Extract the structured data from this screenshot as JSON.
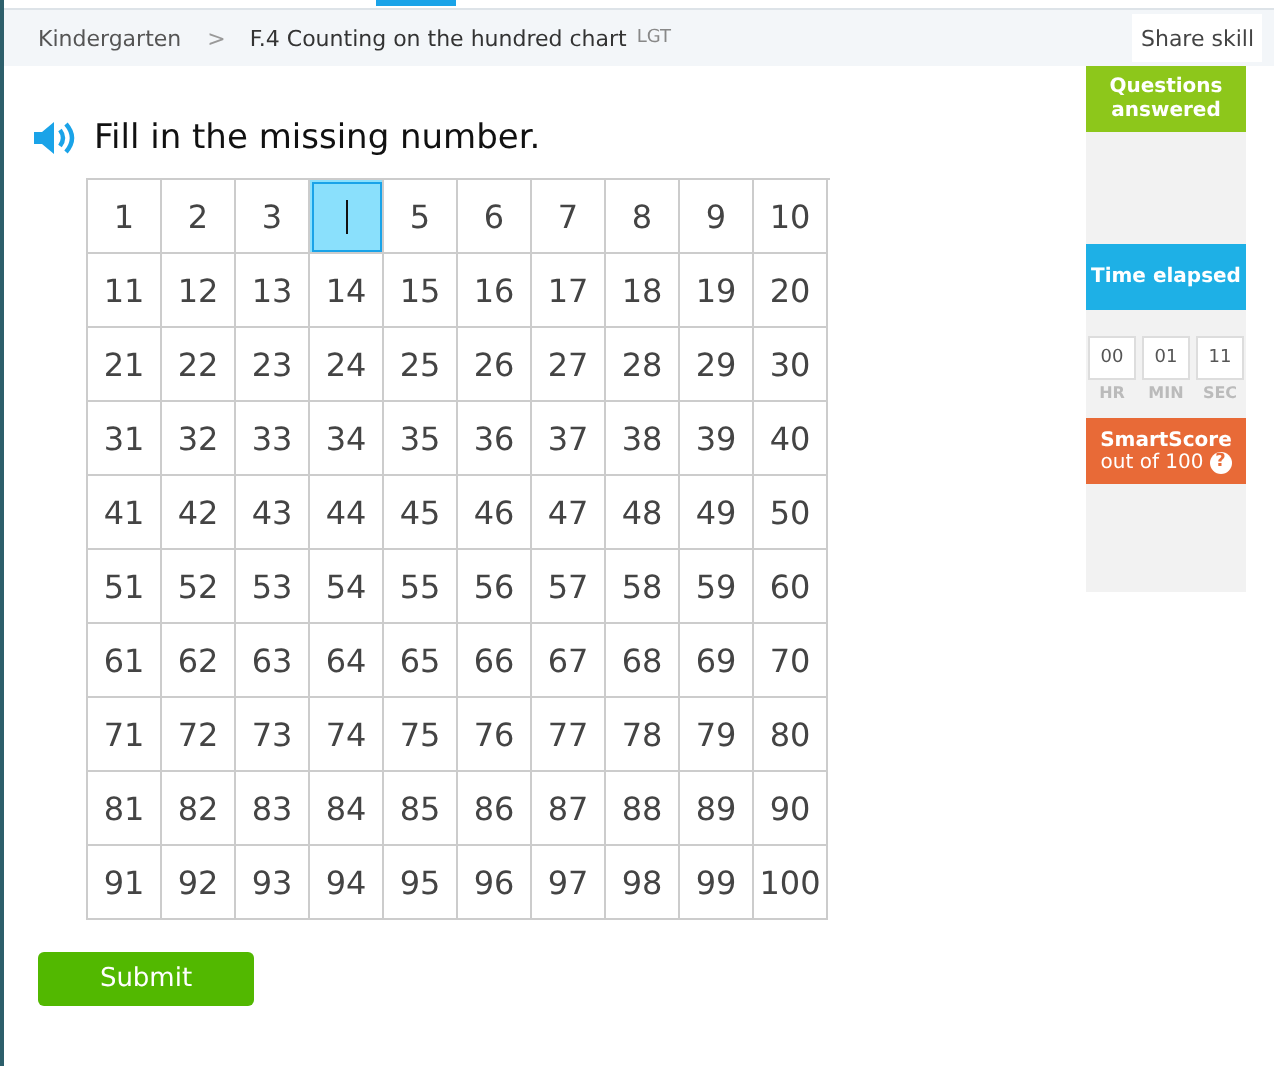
{
  "breadcrumb": {
    "grade": "Kindergarten",
    "separator": ">",
    "skill": "F.4 Counting on the hundred chart",
    "code": "LGT"
  },
  "share_button": "Share skill",
  "question": {
    "prompt": "Fill in the missing number."
  },
  "grid_rows": [
    [
      "1",
      "2",
      "3",
      {
        "kind": "input",
        "focused": true
      },
      "5",
      "6",
      "7",
      "8",
      "9",
      "10"
    ],
    [
      "11",
      "12",
      "13",
      "14",
      "15",
      "16",
      "17",
      "18",
      "19",
      "20"
    ],
    [
      "21",
      "22",
      "23",
      "24",
      "25",
      "26",
      "27",
      "28",
      "29",
      "30"
    ],
    [
      "31",
      "32",
      "33",
      "34",
      "35",
      "36",
      "37",
      "38",
      "39",
      "40"
    ],
    [
      "41",
      "42",
      "43",
      "44",
      "45",
      "46",
      "47",
      "48",
      "49",
      "50"
    ],
    [
      "51",
      "52",
      "53",
      "54",
      "55",
      "56",
      "57",
      "58",
      "59",
      "60"
    ],
    [
      "61",
      "62",
      "63",
      "64",
      "65",
      "66",
      "67",
      "68",
      "69",
      "70"
    ],
    [
      "71",
      "72",
      "73",
      "74",
      "75",
      "76",
      "77",
      "78",
      "79",
      "80"
    ],
    [
      "81",
      "82",
      "83",
      "84",
      "85",
      "86",
      "87",
      "88",
      "89",
      "90"
    ],
    [
      "91",
      "92",
      "93",
      "94",
      "95",
      "96",
      "97",
      "98",
      "99",
      "100"
    ]
  ],
  "submit_button": "Submit",
  "sidebar": {
    "questions_answered": "Questions answered",
    "time_elapsed": "Time elapsed",
    "timer": [
      {
        "value": "00",
        "unit": "HR"
      },
      {
        "value": "01",
        "unit": "MIN"
      },
      {
        "value": "11",
        "unit": "SEC"
      }
    ],
    "smartscore_title": "SmartScore",
    "smartscore_sub": "out of 100",
    "help": "?"
  }
}
